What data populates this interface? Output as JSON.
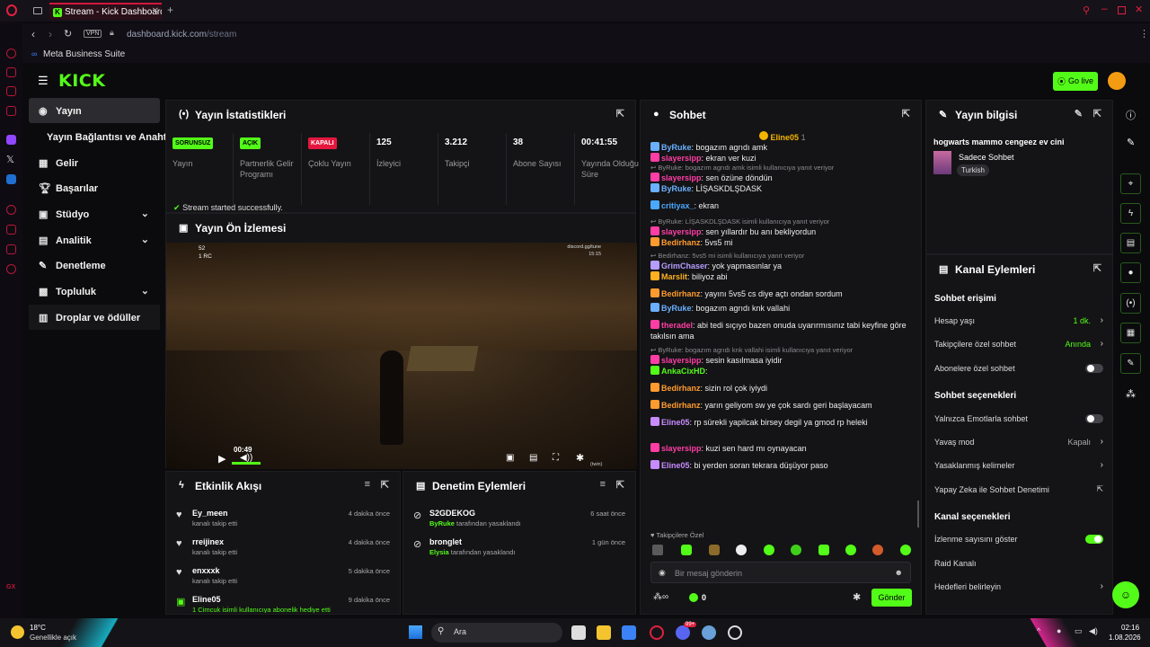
{
  "browser": {
    "tab_title": "Stream - Kick Dashboard",
    "url_host": "dashboard.kick.com",
    "url_path": "/stream",
    "vpn": "VPN",
    "bookmark": "Meta Business Suite",
    "sidebar_label": "GX"
  },
  "header": {
    "logo": "KICK",
    "go_live": "Go live"
  },
  "nav": {
    "items": [
      {
        "label": "Yayın"
      },
      {
        "label": "Yayın Bağlantısı ve Anahtarı"
      },
      {
        "label": "Gelir"
      },
      {
        "label": "Başarılar"
      },
      {
        "label": "Stüdyo"
      },
      {
        "label": "Analitik"
      },
      {
        "label": "Denetleme"
      },
      {
        "label": "Topluluk"
      },
      {
        "label": "Droplar ve ödüller"
      }
    ]
  },
  "stats": {
    "title": "Yayın İstatistikleri",
    "columns": [
      {
        "badge": "SORUNSUZ",
        "label": "Yayın"
      },
      {
        "badge": "AÇIK",
        "label": "Partnerlik Gelir Programı"
      },
      {
        "badge": "KAPALI",
        "label": "Çoklu Yayın"
      },
      {
        "value": "125",
        "label": "İzleyici"
      },
      {
        "value": "3.212",
        "label": "Takipçi"
      },
      {
        "value": "38",
        "label": "Abone Sayısı"
      },
      {
        "value": "00:41:55",
        "label": "Yayında Olduğu Süre"
      }
    ],
    "notice": "Stream started successfully."
  },
  "preview": {
    "title": "Yayın Ön İzlemesi",
    "overlay_count": "52",
    "overlay_rc": "1 RC",
    "overlay_right": "discord.gg/tune",
    "overlay_right2": "15:15",
    "time": "00:49",
    "quality": "(twin)"
  },
  "activity": {
    "title": "Etkinlik Akışı",
    "items": [
      {
        "name": "Ey_meen",
        "sub": "kanalı takip etti",
        "time": "4 dakika önce"
      },
      {
        "name": "rreijinex",
        "sub": "kanalı takip etti",
        "time": "4 dakika önce"
      },
      {
        "name": "enxxxk",
        "sub": "kanalı takip etti",
        "time": "5 dakika önce"
      },
      {
        "name": "Eline05",
        "sub": "1 Cimcuk isimli kullanıcıya abonelik hediye etti",
        "time": "9 dakika önce"
      }
    ]
  },
  "moderation": {
    "title": "Denetim Eylemleri",
    "items": [
      {
        "name": "S2GDEKOG",
        "by": "ByRuke",
        "sub": "tarafından yasaklandı",
        "time": "6 saat önce"
      },
      {
        "name": "bronglet",
        "by": "Elysia",
        "sub": "tarafından yasaklandı",
        "time": "1 gün önce"
      }
    ]
  },
  "chat": {
    "title": "Sohbet",
    "pinned": "Eline05",
    "pinned_count": "1",
    "messages": [
      {
        "user": "ByRuke",
        "color": "#6ab0ff",
        "text": ": bogazım agrıdı amk"
      },
      {
        "user": "slayersipp",
        "color": "#ff3ea5",
        "text": ": ekran ver kuzi"
      },
      {
        "reply": "ByRuke: bogazım agrıdı amk isimli kullanıcıya yanıt veriyor"
      },
      {
        "user": "slayersipp",
        "color": "#ff3ea5",
        "text": ": sen özüne döndün"
      },
      {
        "user": "ByRuke",
        "color": "#6ab0ff",
        "text": ": LİŞASKDLŞDASK"
      },
      {
        "user": "critiyax_",
        "color": "#4aa8ff",
        "text": ": ekran"
      },
      {
        "reply": "ByRuke: LİŞASKDLŞDASK isimli kullanıcıya yanıt veriyor"
      },
      {
        "user": "slayersipp",
        "color": "#ff3ea5",
        "text": ": sen yıllardır bu anı bekliyordun"
      },
      {
        "user": "Bedirhanz",
        "color": "#ff9b2e",
        "text": ": 5vs5 mi"
      },
      {
        "reply": "Bedirhanz: 5vs5 mi isimli kullanıcıya yanıt veriyor"
      },
      {
        "user": "GrimChaser",
        "color": "#b69cff",
        "text": ": yok yapmasınlar ya"
      },
      {
        "user": "Marslit",
        "color": "#ffb020",
        "text": ": biliyoz abi"
      },
      {
        "user": "Bedirhanz",
        "color": "#ff9b2e",
        "text": ": yayını 5vs5 cs diye açtı ondan sordum"
      },
      {
        "user": "ByRuke",
        "color": "#6ab0ff",
        "text": ": bogazım agrıdı knk vallahi"
      },
      {
        "user": "theradel",
        "color": "#ff3ea5",
        "text": ": abi tedi sıçıyo bazen onuda uyarırmısınız tabi keyfine göre takılsın ama"
      },
      {
        "reply": "ByRuke: bogazım agrıdı knk vallahi isimli kullanıcıya yanıt veriyor"
      },
      {
        "user": "slayersipp",
        "color": "#ff3ea5",
        "text": ": sesin kasılmasa iyidir"
      },
      {
        "user": "AnkaCixHD",
        "color": "#53fc18",
        "text": ":"
      },
      {
        "user": "Bedirhanz",
        "color": "#ff9b2e",
        "text": ": sizin rol çok iyiydi"
      },
      {
        "user": "Bedirhanz",
        "color": "#ff9b2e",
        "text": ": yarın geliyom sw ye çok sardı geri başlayacam"
      },
      {
        "user": "Eline05",
        "color": "#c88bff",
        "text": ": rp sürekli yapilcak birsey degil ya gmod rp heleki"
      },
      {
        "user": "slayersipp",
        "color": "#ff3ea5",
        "text": ": kuzi sen hard mı oynayacan"
      },
      {
        "user": "Eline05",
        "color": "#c88bff",
        "text": ": bi yerden soran tekrara düşüyor paso"
      }
    ],
    "followers_only": "Takipçilere Özel",
    "input_placeholder": "Bir mesaj gönderin",
    "points": "0",
    "send": "Gönder"
  },
  "info": {
    "title": "Yayın bilgisi",
    "stream_title": "hogwarts mammo cengeez ev cini",
    "category": "Sadece Sohbet",
    "tag": "Turkish"
  },
  "channel_actions": {
    "title": "Kanal Eylemleri",
    "chat_access": "Sohbet erişimi",
    "account_age": "Hesap yaşı",
    "account_age_val": "1 dk.",
    "followers_chat": "Takipçilere özel sohbet",
    "followers_chat_val": "Anında",
    "subs_chat": "Abonelere özel sohbet",
    "chat_options": "Sohbet seçenekleri",
    "emote_only": "Yalnızca Emotlarla sohbet",
    "slow_mode": "Yavaş mod",
    "slow_mode_val": "Kapalı",
    "banned_words": "Yasaklanmış kelimeler",
    "ai_mod": "Yapay Zeka ile Sohbet Denetimi",
    "channel_options": "Kanal seçenekleri",
    "show_viewers": "İzlenme sayısını göster",
    "raid": "Raid Kanalı",
    "goals": "Hedefleri belirleyin"
  },
  "taskbar": {
    "temp": "18°C",
    "weather": "Genellikle açık",
    "search": "Ara",
    "time": "02:16",
    "date": "1.08.2026",
    "badge": "99+"
  },
  "colors": {
    "accent": "#53fc18",
    "brand_red": "#d2173f",
    "panel": "#141416"
  }
}
